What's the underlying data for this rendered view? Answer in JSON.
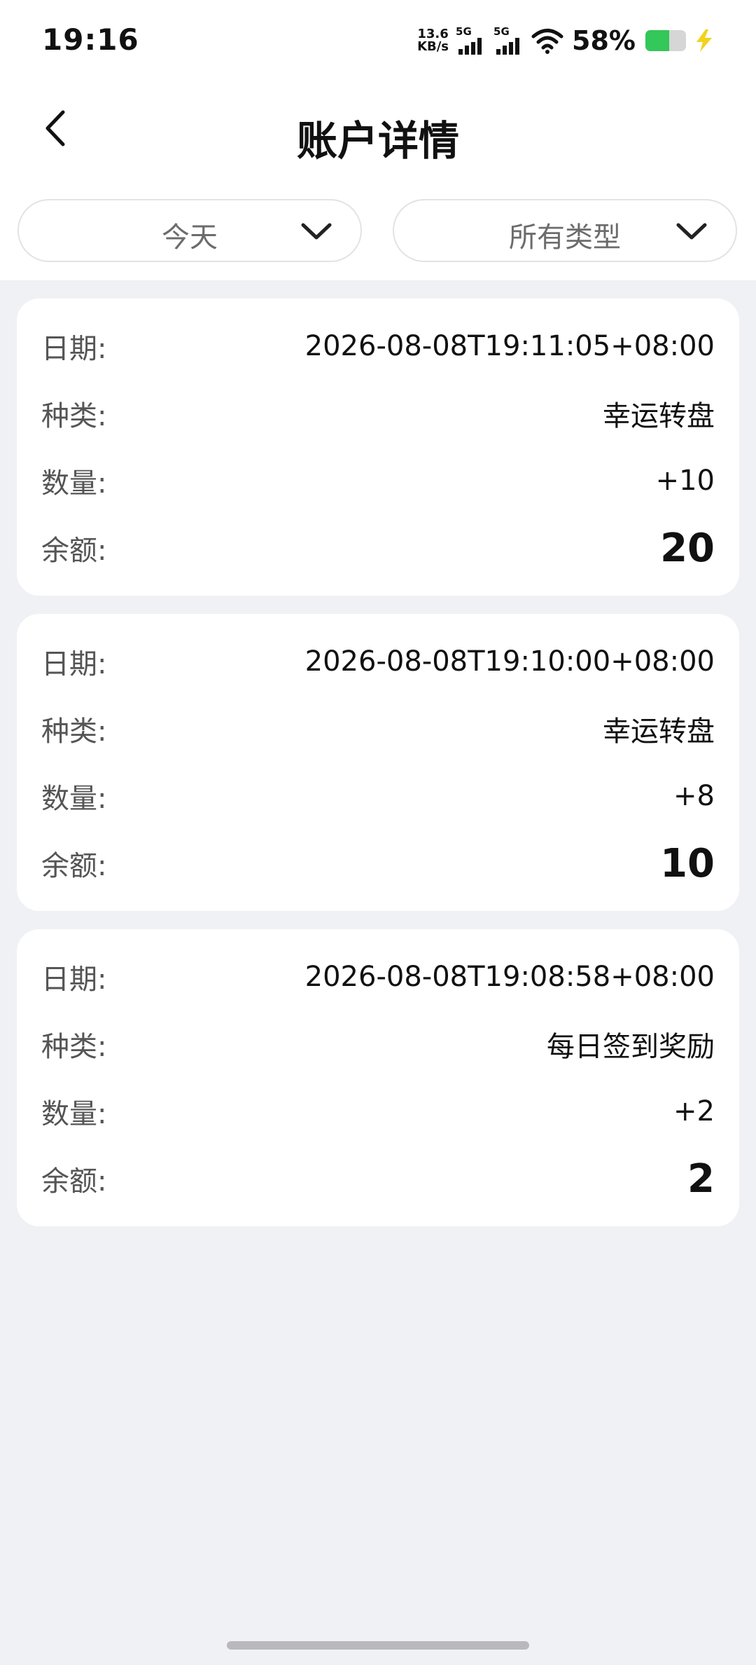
{
  "status_bar": {
    "time": "19:16",
    "net_speed_value": "13.6",
    "net_speed_unit": "KB/s",
    "sim1_tag": "5G",
    "sim2_tag": "5G",
    "battery_percent_text": "58%",
    "battery_level": 0.58,
    "battery_color": "#34c759",
    "charging_color": "#f2d21b",
    "icons": [
      "signal-icon",
      "signal-icon",
      "wifi-icon",
      "battery-icon",
      "charging-bolt-icon"
    ]
  },
  "header": {
    "title": "账户详情",
    "back_icon": "chevron-left-icon"
  },
  "filters": {
    "date_filter": "今天",
    "type_filter": "所有类型",
    "chevron_icon": "chevron-down-icon"
  },
  "labels": {
    "date": "日期:",
    "type": "种类:",
    "amount": "数量:",
    "balance": "余额:"
  },
  "records": [
    {
      "date": "2026-08-08T19:11:05+08:00",
      "type": "幸运转盘",
      "amount": "+10",
      "balance": "20"
    },
    {
      "date": "2026-08-08T19:10:00+08:00",
      "type": "幸运转盘",
      "amount": "+8",
      "balance": "10"
    },
    {
      "date": "2026-08-08T19:08:58+08:00",
      "type": "每日签到奖励",
      "amount": "+2",
      "balance": "2"
    }
  ]
}
